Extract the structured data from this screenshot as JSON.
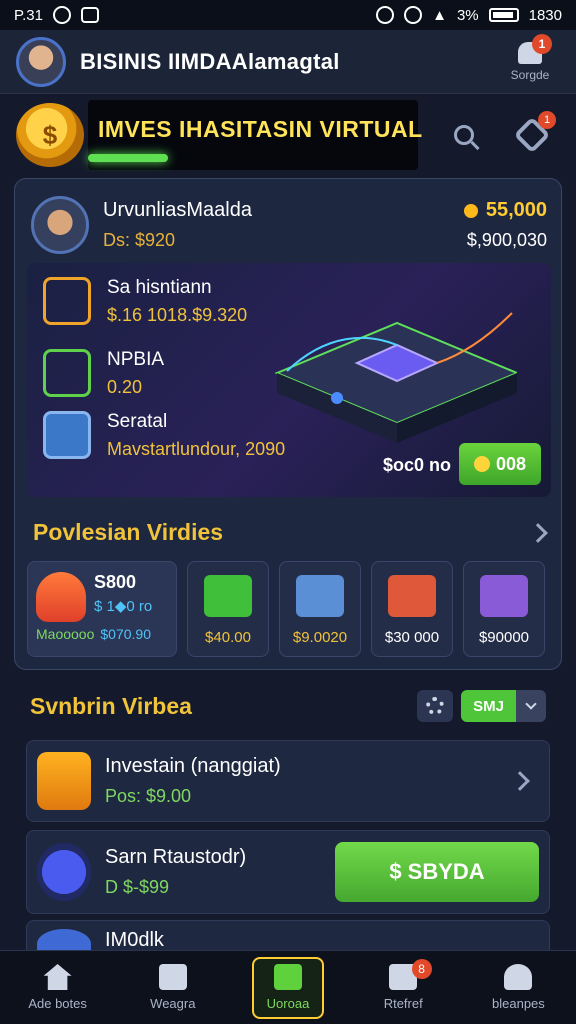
{
  "status_bar": {
    "time": "P.31",
    "battery_pct": "3%",
    "clock": "1830"
  },
  "app_bar": {
    "title": "BISINIS IIMDAAlamagtal",
    "notif_label": "Sorgde",
    "notif_count": "1"
  },
  "banner": {
    "text": "IMVES IHASITASIN VIRTUAL",
    "tools_badge": "1"
  },
  "user": {
    "name": "UrvunliasMaalda",
    "sub": "Ds: $920",
    "coins": "55,000",
    "total": "$,900,030"
  },
  "hero": {
    "items": [
      {
        "title": "Sa hisntiann",
        "value": "$.16 1018.$9.320"
      },
      {
        "title": "NPBIA",
        "value": "0.20"
      },
      {
        "title": "Seratal",
        "value": "Mavstartlundour, 2090"
      }
    ],
    "price": "$oc0 no",
    "button_label": "008"
  },
  "section1": {
    "title": "Povlesian Virdies",
    "featured": {
      "title": "S800",
      "sub": "$ 1◆0 ro",
      "left": "Maooooo",
      "right": "$070.90"
    },
    "tiles": [
      {
        "price": "$40.00",
        "icon_color": "#3fbf3a"
      },
      {
        "price": "$9.0020",
        "icon_color": "#5a8fd6"
      },
      {
        "price": "$30 000",
        "icon_color": "#e0583a"
      },
      {
        "price": "$90000",
        "icon_color": "#8a5bd6"
      }
    ]
  },
  "section2": {
    "title": "Svnbrin Virbea",
    "select_value": "SMJ",
    "items": [
      {
        "title": "Investain (nanggiat)",
        "sub": "Pos: $9.00"
      },
      {
        "title": "Sarn Rtaustodr)",
        "sub": "D $-$99",
        "button": "$ SBYDA"
      },
      {
        "title": "IM0dlk"
      }
    ]
  },
  "bottom_nav": [
    {
      "label": "Ade botes"
    },
    {
      "label": "Weagra"
    },
    {
      "label": "Uoroaa"
    },
    {
      "label": "Rtefref",
      "badge": "8"
    },
    {
      "label": "bleanpes"
    }
  ],
  "colors": {
    "accent_gold": "#f1c33a",
    "accent_green": "#4fc63a",
    "badge_red": "#e04a2a"
  }
}
